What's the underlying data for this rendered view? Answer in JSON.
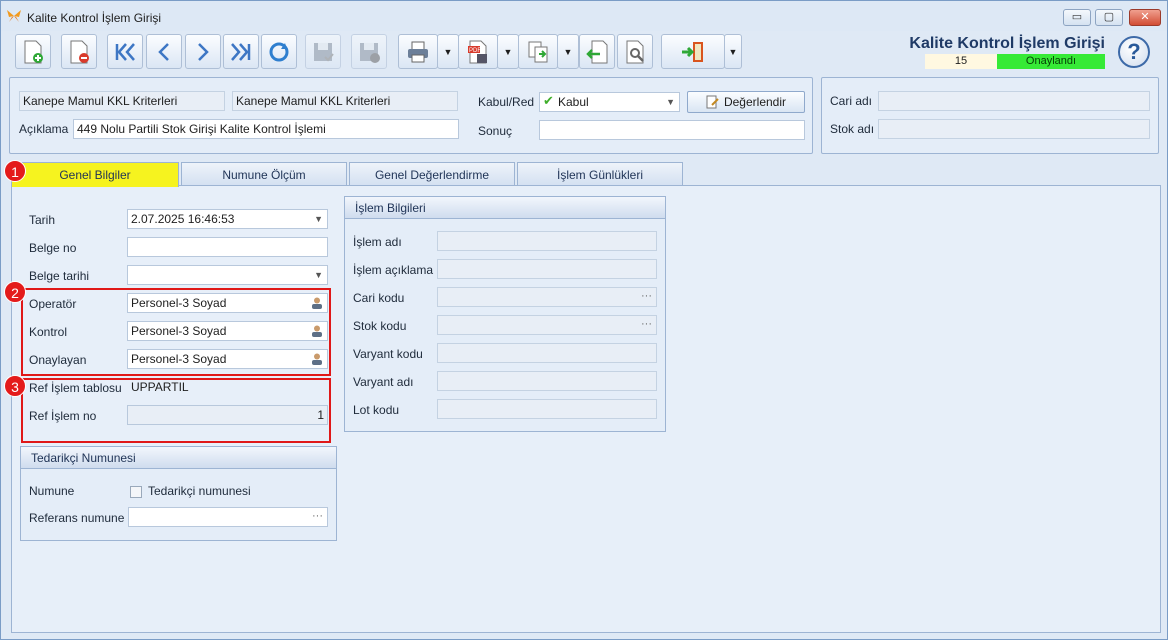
{
  "window": {
    "title": "Kalite Kontrol İşlem Girişi"
  },
  "form": {
    "title": "Kalite Kontrol İşlem Girişi",
    "record_no": "15",
    "status": "Onaylandı",
    "status_color": "#36ea36"
  },
  "header": {
    "criteria_1": "Kanepe Mamul KKL Kriterleri",
    "criteria_2": "Kanepe Mamul KKL Kriterleri",
    "aciklama_label": "Açıklama",
    "aciklama_value": "449 Nolu Partili Stok Girişi Kalite Kontrol İşlemi",
    "kabul_red_label": "Kabul/Red",
    "kabul_red_value": "Kabul",
    "degerlendir_label": "Değerlendir",
    "sonuc_label": "Sonuç",
    "sonuc_value": "",
    "cari_adi_label": "Cari adı",
    "cari_adi_value": "",
    "stok_adi_label": "Stok adı",
    "stok_adi_value": ""
  },
  "tabs": [
    {
      "label": "Genel Bilgiler",
      "active": true
    },
    {
      "label": "Numune Ölçüm"
    },
    {
      "label": "Genel Değerlendirme"
    },
    {
      "label": "İşlem Günlükleri"
    }
  ],
  "general": {
    "tarih_label": "Tarih",
    "tarih_value": "2.07.2025 16:46:53",
    "belge_no_label": "Belge no",
    "belge_no_value": "",
    "belge_tarihi_label": "Belge tarihi",
    "belge_tarihi_value": "",
    "operator_label": "Operatör",
    "operator_value": "Personel-3 Soyad",
    "kontrol_label": "Kontrol",
    "kontrol_value": "Personel-3 Soyad",
    "onaylayan_label": "Onaylayan",
    "onaylayan_value": "Personel-3 Soyad",
    "ref_tablo_label": "Ref İşlem tablosu",
    "ref_tablo_value": "UPPARTIL",
    "ref_no_label": "Ref İşlem no",
    "ref_no_value": "1"
  },
  "supplier": {
    "title": "Tedarikçi Numunesi",
    "numune_label": "Numune",
    "tedarikci_checkbox_label": "Tedarikçi numunesi",
    "tedarikci_checked": false,
    "referans_label": "Referans numune",
    "referans_value": ""
  },
  "islem": {
    "title": "İşlem Bilgileri",
    "fields": [
      {
        "label": "İşlem adı",
        "value": ""
      },
      {
        "label": "İşlem açıklama",
        "value": ""
      },
      {
        "label": "Cari kodu",
        "value": ""
      },
      {
        "label": "Stok kodu",
        "value": ""
      },
      {
        "label": "Varyant kodu",
        "value": ""
      },
      {
        "label": "Varyant adı",
        "value": ""
      },
      {
        "label": "Lot kodu",
        "value": ""
      }
    ]
  },
  "badges": [
    "1",
    "2",
    "3"
  ],
  "window_buttons": {
    "minimize": "▭",
    "maximize": "▢",
    "close": "✕"
  },
  "help_glyph": "?",
  "icons": [
    "new-document-icon",
    "delete-document-icon",
    "first-record-icon",
    "previous-record-icon",
    "next-record-icon",
    "last-record-icon",
    "refresh-icon",
    "save-icon",
    "cancel-save-icon",
    "print-icon",
    "pdf-export-icon",
    "copy-icon",
    "import-icon",
    "document-settings-icon",
    "exit-door-icon",
    "help-icon",
    "butterfly-app-icon",
    "person-search-icon"
  ]
}
